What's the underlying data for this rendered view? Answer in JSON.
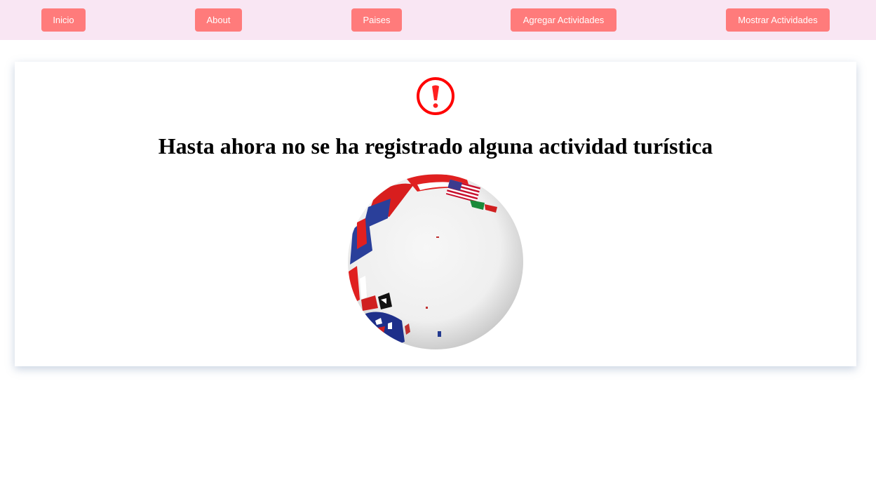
{
  "nav": {
    "items": [
      {
        "label": "Inicio"
      },
      {
        "label": "About"
      },
      {
        "label": "Paises"
      },
      {
        "label": "Agregar Actividades"
      },
      {
        "label": "Mostrar Actividades"
      }
    ]
  },
  "message": {
    "icon": "exclamation-circle-icon",
    "title": "Hasta ahora no se ha registrado alguna actividad turística"
  },
  "image": {
    "icon": "globe-flags-image"
  },
  "colors": {
    "nav_background": "#f9e6f3",
    "button": "#ff7b7b",
    "alert": "#ff0000"
  }
}
